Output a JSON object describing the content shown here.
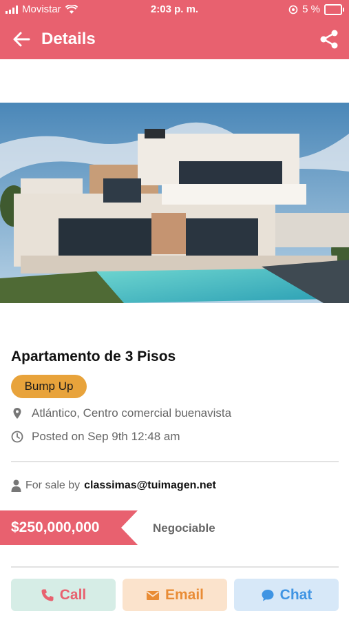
{
  "status_bar": {
    "carrier": "Movistar",
    "time": "2:03 p. m.",
    "battery": "5 %"
  },
  "app_bar": {
    "title": "Details"
  },
  "listing": {
    "title": "Apartamento de 3 Pisos",
    "badge": "Bump Up",
    "location": "Atlántico, Centro comercial buenavista",
    "posted": "Posted on Sep 9th 12:48 am",
    "seller_prefix": "For sale by",
    "seller_email": "classimas@tuimagen.net",
    "price": "$250,000,000",
    "negotiable": "Negociable"
  },
  "actions": {
    "call": "Call",
    "email": "Email",
    "chat": "Chat"
  },
  "colors": {
    "primary": "#e8616f",
    "badge": "#e8a33b",
    "call_bg": "#d6ede6",
    "email_bg": "#fbe3cc",
    "chat_bg": "#d7e8f8"
  }
}
